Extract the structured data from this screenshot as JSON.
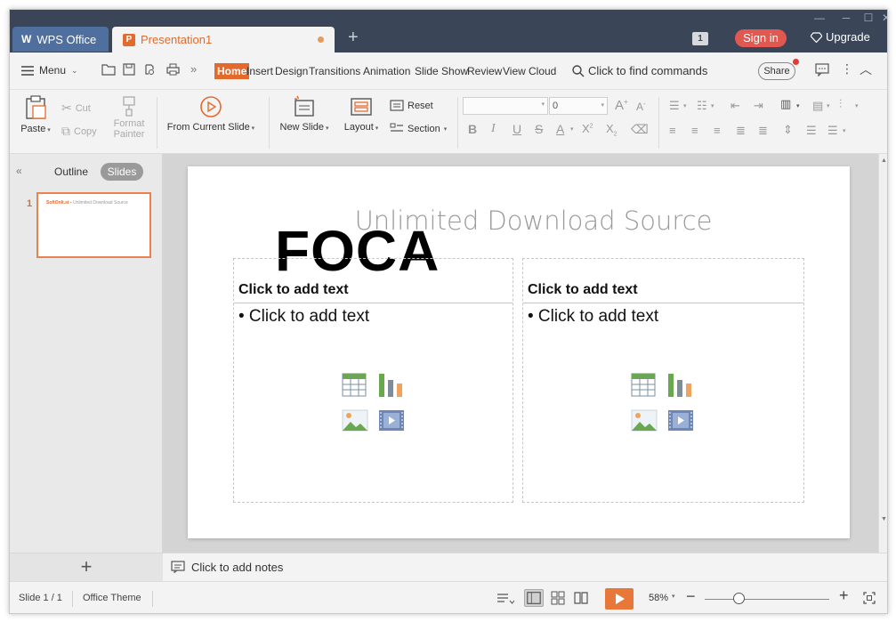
{
  "titlebar": {
    "app_tab": "WPS Office",
    "doc_tab": "Presentation1",
    "counter": "1",
    "signin": "Sign in",
    "upgrade": "Upgrade"
  },
  "menubar": {
    "menu_label": "Menu",
    "tabs": [
      "Home",
      "Insert",
      "Design",
      "Transitions",
      "Animation",
      "Slide Show",
      "Review",
      "View",
      "Cloud"
    ],
    "active_tab": "Home",
    "find_placeholder": "Click to find commands",
    "share": "Share"
  },
  "ribbon": {
    "paste": "Paste",
    "cut": "Cut",
    "copy": "Copy",
    "format_painter_1": "Format",
    "format_painter_2": "Painter",
    "from_current": "From Current Slide",
    "new_slide": "New Slide",
    "layout": "Layout",
    "reset": "Reset",
    "section": "Section",
    "font_size": "0"
  },
  "leftpanel": {
    "outline_tab": "Outline",
    "slides_tab": "Slides",
    "slide_number": "1",
    "thumb_brand": "SoftOnIt.st",
    "thumb_text": "Unlimited Download Source"
  },
  "slide": {
    "title": "Unlimited Download Source",
    "overlay": "FOCA",
    "left_heading": "Click to add text",
    "left_bullet": "• Click to add text",
    "right_heading": "Click to add text",
    "right_bullet": "• Click to add text"
  },
  "notes": {
    "placeholder": "Click to add notes"
  },
  "status": {
    "slide_count": "Slide 1 / 1",
    "theme": "Office Theme",
    "zoom": "58%"
  },
  "colors": {
    "accent": "#e26a2c",
    "titlebar": "#3a4557",
    "signin": "#e0584f"
  }
}
